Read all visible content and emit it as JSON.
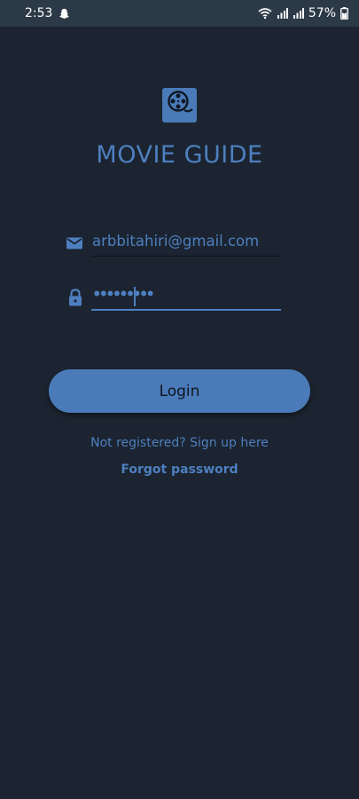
{
  "status_bar": {
    "time": "2:53",
    "battery": "57%",
    "icons": [
      "snapchat-icon",
      "wifi-icon",
      "signal-icon",
      "signal-icon",
      "battery-icon"
    ]
  },
  "app": {
    "title": "MOVIE GUIDE",
    "logo_icon": "film-reel-icon"
  },
  "form": {
    "email": {
      "value": "arbbitahiri@gmail.com",
      "icon": "mail-icon"
    },
    "password": {
      "value": "•••••••••",
      "icon": "lock-icon"
    },
    "login_label": "Login",
    "signup_link": "Not registered? Sign up here",
    "forgot_link": "Forgot password"
  },
  "colors": {
    "background": "#1b2430",
    "status_bar": "#2c3947",
    "accent": "#4a7ab8",
    "text_accent": "#4e7fc0"
  }
}
